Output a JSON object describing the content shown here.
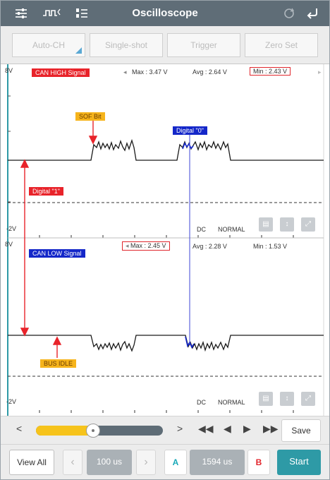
{
  "header": {
    "title": "Oscilloscope"
  },
  "modes": [
    {
      "label": "Auto-CH"
    },
    {
      "label": "Single-shot"
    },
    {
      "label": "Trigger"
    },
    {
      "label": "Zero Set"
    }
  ],
  "channel1": {
    "scale_top": "8V",
    "scale_bottom": "-2V",
    "name": "CAN HIGH Signal",
    "max": "Max : 3.47 V",
    "avg": "Avg : 2.64 V",
    "min": "Min : 2.43 V",
    "coupling": "DC",
    "mode": "NORMAL"
  },
  "channel2": {
    "scale_top": "8V",
    "scale_bottom": "-2V",
    "name": "CAN LOW Signal",
    "max": "Max : 2.45 V",
    "avg": "Avg : 2.28 V",
    "min": "Min : 1.53 V",
    "coupling": "DC",
    "mode": "NORMAL"
  },
  "annotations": {
    "sof_bit": "SOF Bit",
    "digital_0": "Digital \"0\"",
    "digital_1": "Digital \"1\"",
    "bus_idle": "BUS IDLE"
  },
  "playback": {
    "save_label": "Save",
    "position_fraction": 0.45
  },
  "nav": {
    "view_all": "View All",
    "time_div": "100 us",
    "cursor_a": "A",
    "cursor_value": "1594 us",
    "cursor_b": "B",
    "start": "Start"
  },
  "colors": {
    "header": "#5f6d77",
    "accent": "#2e9aa6",
    "cursor_a": "#18a9b8",
    "cursor_b": "#e2232a",
    "trace": "#1a1a1a",
    "digital_0_trace": "#1427c9",
    "annotation_red": "#e8232a",
    "slider_fill": "#f6c31b"
  }
}
